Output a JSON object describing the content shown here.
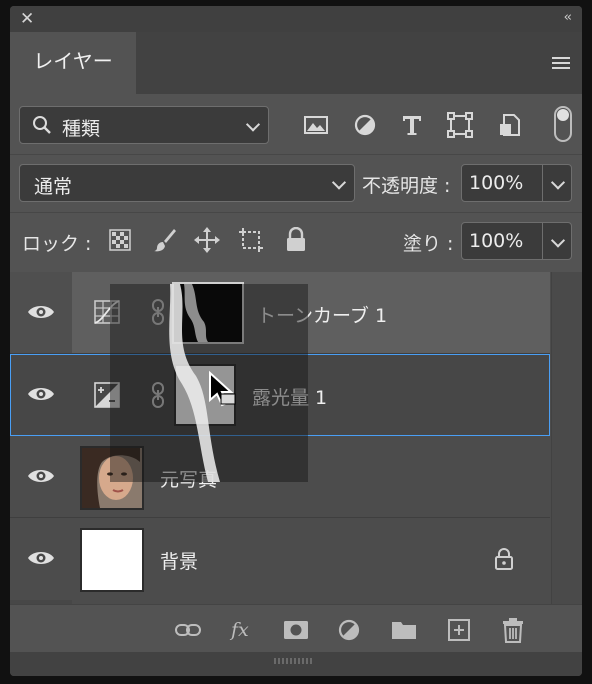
{
  "panel": {
    "tab_label": "レイヤー",
    "collapse_glyph": "‹‹",
    "close_glyph": "✕"
  },
  "filter": {
    "kind_label": "種類",
    "icons": [
      "image-filter-icon",
      "adjustment-filter-icon",
      "type-filter-icon",
      "shape-filter-icon",
      "smart-object-filter-icon",
      "filter-toggle-icon"
    ]
  },
  "blend": {
    "mode": "通常",
    "opacity_label": "不透明度 :",
    "opacity_value": "100%"
  },
  "lock": {
    "label": "ロック :",
    "fill_label": "塗り :",
    "fill_value": "100%"
  },
  "layers": [
    {
      "name": "トーンカーブ 1",
      "type": "curves-adjustment",
      "selected": false,
      "visible": true
    },
    {
      "name": "露光量 1",
      "type": "exposure-adjustment",
      "selected": true,
      "visible": true
    },
    {
      "name": "元写真",
      "type": "photo",
      "selected": false,
      "visible": true
    },
    {
      "name": "背景",
      "type": "background",
      "selected": false,
      "visible": true,
      "locked": true
    }
  ],
  "colors": {
    "panel_bg": "#535353",
    "selection_border": "#4a9ff5",
    "window_bg": "#111111"
  }
}
